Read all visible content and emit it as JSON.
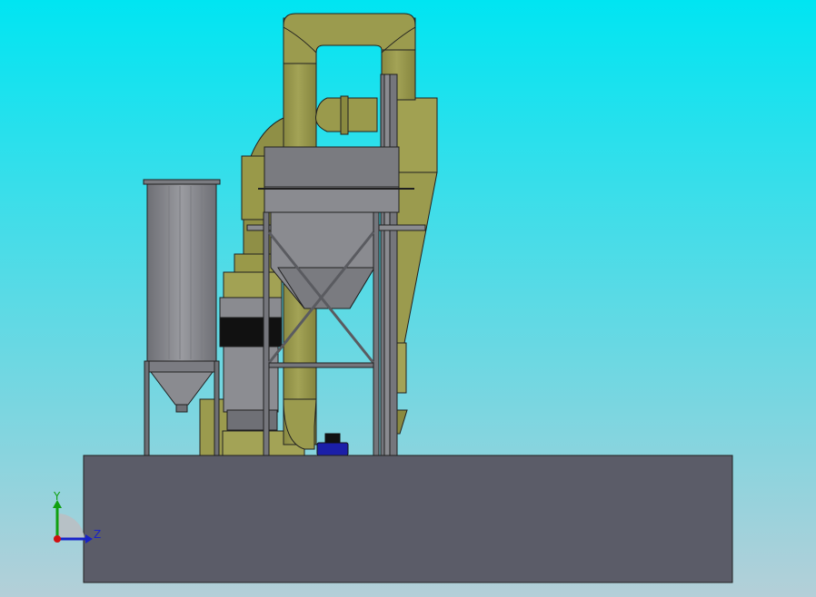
{
  "viewport": {
    "background_top": "#00e5f2",
    "background_bottom": "#b4cfd8"
  },
  "triad": {
    "y_label": "Y",
    "z_label": "Z",
    "y_color": "#10a010",
    "z_color": "#1822c8",
    "x_color": "#d01010"
  },
  "colors": {
    "duct": "#9b9b4e",
    "duct_dark": "#7d7d3a",
    "steel": "#75767c",
    "steel_light": "#8a8b90",
    "foundation": "#5b5c68",
    "motor": "#1b1fa8",
    "edge": "#202020"
  },
  "icons": {
    "triad": "axis-triad-icon"
  }
}
